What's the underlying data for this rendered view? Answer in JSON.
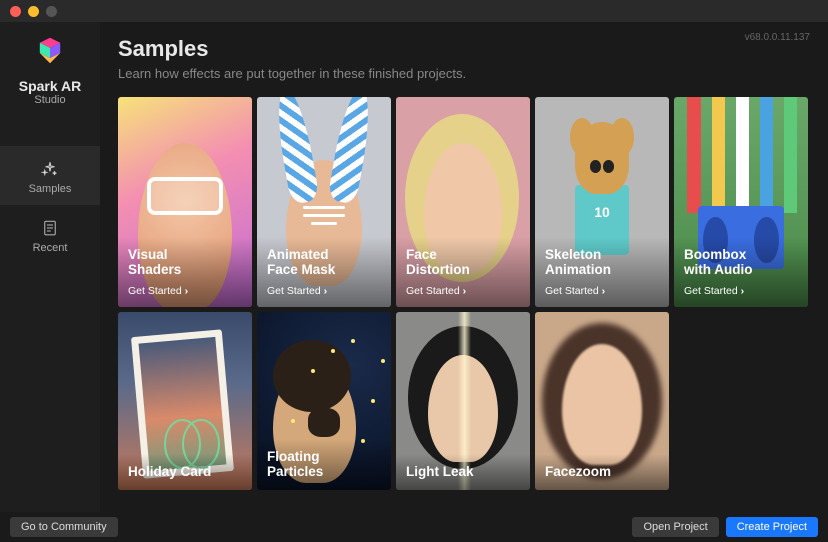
{
  "version": "v68.0.0.11.137",
  "brand": {
    "name": "Spark AR",
    "sub": "Studio"
  },
  "nav": {
    "samples": "Samples",
    "recent": "Recent"
  },
  "page": {
    "title": "Samples",
    "subtitle": "Learn how effects are put together in these finished projects."
  },
  "cta": "Get Started",
  "cards_row1": [
    {
      "title": "Visual\nShaders"
    },
    {
      "title": "Animated\nFace Mask"
    },
    {
      "title": "Face\nDistortion"
    },
    {
      "title": "Skeleton\nAnimation"
    },
    {
      "title": "Boombox\nwith Audio"
    }
  ],
  "cards_row2": [
    {
      "title": "Holiday Card"
    },
    {
      "title": "Floating\nParticles"
    },
    {
      "title": "Light Leak"
    },
    {
      "title": "Facezoom"
    }
  ],
  "buttons": {
    "community": "Go to Community",
    "open": "Open Project",
    "create": "Create Project"
  }
}
